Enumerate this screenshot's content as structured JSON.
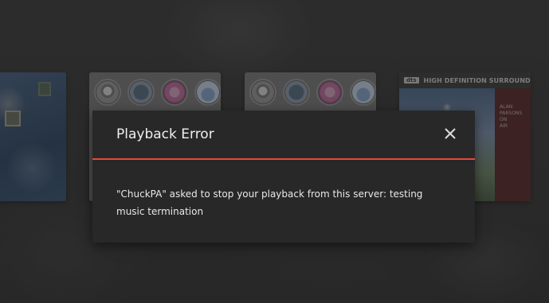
{
  "dialog": {
    "title": "Playback Error",
    "message": "\"ChuckPA\" asked to stop your playback from this server: testing music termination",
    "accent_color": "#e5493b",
    "close_icon": "close-icon"
  },
  "albums": [
    {
      "name": "album-art-1"
    },
    {
      "name": "album-art-2"
    },
    {
      "name": "album-art-3"
    },
    {
      "name": "album-art-4",
      "brand": "dts",
      "banner": "HIGH DEFINITION SURROUND™",
      "side_text": [
        "ALAN",
        "PARSONS",
        "ON",
        "AIR"
      ]
    }
  ]
}
